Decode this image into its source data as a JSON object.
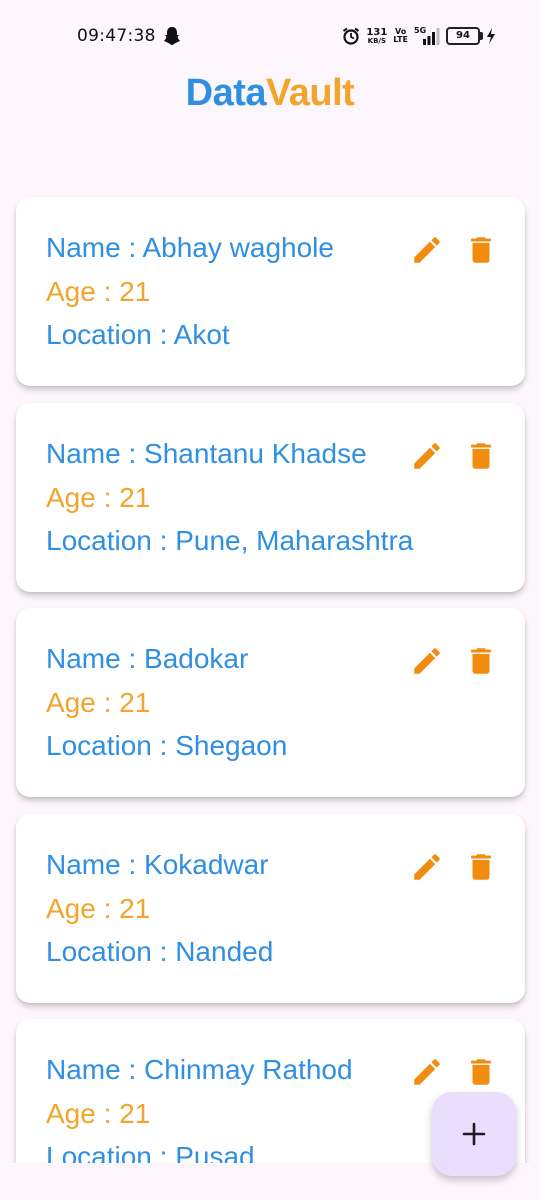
{
  "status_bar": {
    "time": "09:47:38",
    "speed_value": "131",
    "speed_unit": "KB/S",
    "volte_top": "Vo",
    "volte_bottom": "LTE",
    "network": "5G",
    "battery": "94"
  },
  "app": {
    "title_part1": "Data",
    "title_part2": "Vault",
    "colors": {
      "blue": "#2f8fe3",
      "orange": "#f2a42c"
    }
  },
  "records": [
    {
      "name": "Name : Abhay waghole",
      "age": "Age : 21",
      "location": "Location : Akot"
    },
    {
      "name": "Name : Shantanu Khadse",
      "age": "Age : 21",
      "location": "Location : Pune, Maharashtra"
    },
    {
      "name": "Name : Badokar",
      "age": "Age : 21",
      "location": "Location : Shegaon"
    },
    {
      "name": "Name : Kokadwar",
      "age": "Age : 21",
      "location": "Location : Nanded"
    },
    {
      "name": "Name : Chinmay Rathod",
      "age": "Age : 21",
      "location": "Location : Pusad"
    }
  ],
  "icons": {
    "edit": "edit-icon",
    "delete": "delete-icon",
    "fab": "plus-icon"
  }
}
